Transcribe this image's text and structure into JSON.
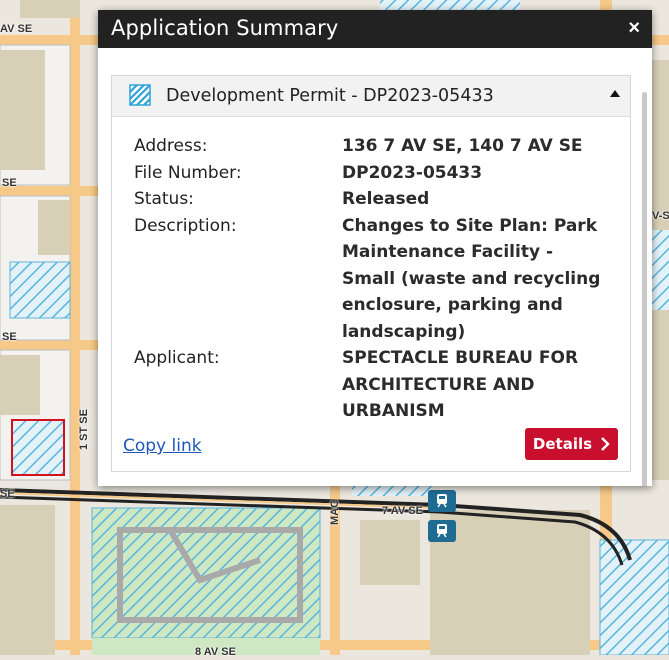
{
  "map": {
    "street_labels": {
      "ave_se_top": "AV SE",
      "se_left_1": "SE",
      "se_left_2": "SE",
      "first_st_se": "1 ST SE",
      "se_bottom_left": "SE",
      "seventh_av_se": "7 AV SE",
      "mac": "MAC",
      "v_se_right": "V-S",
      "eighth_av_se": "8 AV SE"
    },
    "transit_icons": [
      "train-icon",
      "train-icon"
    ]
  },
  "popup": {
    "title": "Application Summary",
    "close_label": "×",
    "card": {
      "title": "Development Permit - DP2023-05433",
      "fields": [
        {
          "label": "Address:",
          "value": "136 7 AV SE, 140 7 AV SE"
        },
        {
          "label": "File Number:",
          "value": "DP2023-05433"
        },
        {
          "label": "Status:",
          "value": "Released"
        },
        {
          "label": "Description:",
          "value": "Changes to Site Plan: Park Maintenance Facility - Small (waste and recycling enclosure, parking and landscaping)"
        },
        {
          "label": "Applicant:",
          "value": "SPECTACLE BUREAU FOR ARCHITECTURE AND URBANISM"
        }
      ],
      "copy_link_label": "Copy link",
      "details_label": "Details"
    }
  },
  "colors": {
    "header_bg": "#222222",
    "accent_red": "#c8102e",
    "link_blue": "#1f58b8",
    "map_bg": "#e9e5dc",
    "building": "#d8cfb7",
    "road": "#f6c989",
    "hatch_blue": "#5ab4dc"
  }
}
